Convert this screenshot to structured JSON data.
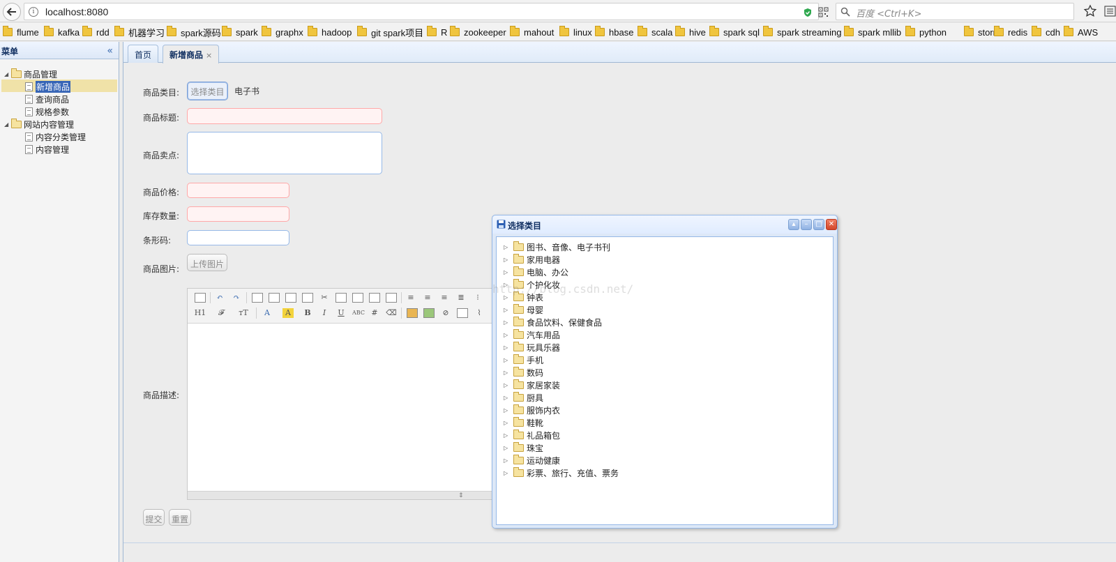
{
  "browser": {
    "url": "localhost:8080",
    "search_placeholder": "百度 <Ctrl+K>",
    "bookmarks": [
      "flume",
      "kafka",
      "rdd",
      "机器学习",
      "spark源码",
      "spark",
      "graphx",
      "hadoop",
      "git spark项目",
      "R",
      "zookeeper",
      "mahout",
      "linux",
      "hbase",
      "scala",
      "hive",
      "spark sql",
      "spark streaming",
      "spark mllib",
      "python",
      "storm",
      "redis",
      "cdh",
      "AWS"
    ]
  },
  "sidebar": {
    "title": "菜单",
    "groups": [
      {
        "label": "商品管理",
        "items": [
          "新增商品",
          "查询商品",
          "规格参数"
        ]
      },
      {
        "label": "网站内容管理",
        "items": [
          "内容分类管理",
          "内容管理"
        ]
      }
    ]
  },
  "tabs": [
    {
      "label": "首页",
      "active": false
    },
    {
      "label": "新增商品",
      "active": true,
      "close": "×"
    }
  ],
  "form": {
    "category_label": "商品类目:",
    "category_button": "选择类目",
    "category_value": "电子书",
    "title_label": "商品标题:",
    "sellpoint_label": "商品卖点:",
    "price_label": "商品价格:",
    "stock_label": "库存数量:",
    "barcode_label": "条形码:",
    "image_label": "商品图片:",
    "upload_button": "上传图片",
    "desc_label": "商品描述:",
    "submit_button": "提交",
    "reset_button": "重置"
  },
  "editor": {
    "toolbar_row2": [
      "H1",
      "𝓕",
      "тT",
      "A",
      "A",
      "B",
      "I",
      "U",
      "ABC"
    ]
  },
  "dialog": {
    "title": "选择类目",
    "categories": [
      "图书、音像、电子书刊",
      "家用电器",
      "电脑、办公",
      "个护化妆",
      "钟表",
      "母婴",
      "食品饮料、保健食品",
      "汽车用品",
      "玩具乐器",
      "手机",
      "数码",
      "家居家装",
      "厨具",
      "服饰内衣",
      "鞋靴",
      "礼品箱包",
      "珠宝",
      "运动健康",
      "彩票、旅行、充值、票务"
    ]
  },
  "watermark": "http://blog.csdn.net/",
  "colors": {
    "accent": "#95b8e7",
    "invalid_border": "#ffa8a8",
    "selected_bg": "#3765b6",
    "folder": "#f0c53e"
  }
}
